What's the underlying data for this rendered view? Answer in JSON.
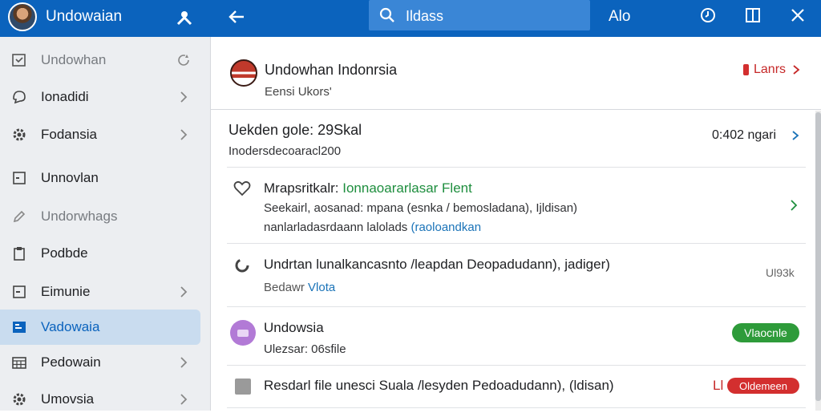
{
  "sidebar": {
    "title": "Undowaian",
    "items": [
      {
        "label": "Undowhan",
        "icon": "checkbox-icon",
        "trail_icon": "refresh-icon"
      },
      {
        "label": "Ionadidi",
        "icon": "chat-bubble-icon",
        "trail_icon": "chevron-right-icon"
      },
      {
        "label": "Fodansia",
        "icon": "gear-icon",
        "trail_icon": "chevron-right-icon"
      },
      {
        "label": "Unnovlan",
        "icon": "square-icon",
        "trail_icon": ""
      },
      {
        "label": "Undorwhags",
        "icon": "pencil-icon",
        "trail_icon": ""
      },
      {
        "label": "Podbde",
        "icon": "clipboard-icon",
        "trail_icon": ""
      },
      {
        "label": "Eimunie",
        "icon": "square-icon",
        "trail_icon": "chevron-right-icon"
      },
      {
        "label": "Vadowaia",
        "icon": "book-icon",
        "trail_icon": "",
        "active": true
      },
      {
        "label": "Pedowain",
        "icon": "calendar-icon",
        "trail_icon": "chevron-right-icon"
      },
      {
        "label": "Umovsia",
        "icon": "gear-icon",
        "trail_icon": "chevron-right-icon"
      }
    ]
  },
  "topbar": {
    "search_value": "Ildass",
    "label": "Alo"
  },
  "content": {
    "title": "Undowhan Indonrsia",
    "subtitle": "Eensi  Ukors'",
    "action_label": "Lanrs"
  },
  "rows": [
    {
      "line1": "Uekden gole: 29Skal",
      "line2": "Inodersdecoaracl200",
      "right_text": "0:402 ngari"
    },
    {
      "line1_label": "Mrapsritkalr:",
      "line1_highlight": "Ionnaoararlasar Flent",
      "line2": "Seekairl, aosanad: mpana (esnka / bemosladana), Ijldisan)",
      "line3_plain": "nanlarladasrdaann lalolads",
      "line3_link": "(raoloandkan"
    },
    {
      "line1": "Undrtan lunalkancasnto /leapdan Deopadudann), jadiger)",
      "line2_plain": "Bedawr",
      "line2_link": "Vlota",
      "right_text": "Ul93k"
    },
    {
      "line1": "Undowsia",
      "line2": "Ulezsar: 06sfile",
      "badge": "Vlaocnle"
    },
    {
      "line1": "Resdarl file unesci Suala /lesyden Pedoadudann), (ldisan)",
      "badge_prefix": "Ll",
      "badge": "Oldemeen"
    }
  ],
  "colors": {
    "brand": "#0b63bd",
    "active_bg": "#c9dcef",
    "green": "#1e8e3e",
    "red": "#c62828",
    "purple": "#b27ad6"
  }
}
